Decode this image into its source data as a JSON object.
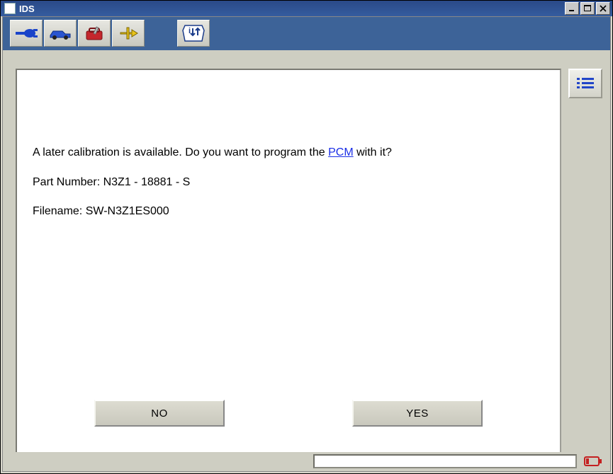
{
  "window": {
    "title": "IDS"
  },
  "message": {
    "line1_pre": "A later calibration is available. Do you want to program the ",
    "line1_link": "PCM",
    "line1_post": " with it?",
    "part_label": "Part Number:  ",
    "part_value": "N3Z1 - 18881 - S",
    "file_label": "Filename:  ",
    "file_value": "SW-N3Z1ES000"
  },
  "buttons": {
    "no": "NO",
    "yes": "YES"
  },
  "toolbar_icons": [
    "connector-icon",
    "vehicle-icon",
    "toolbox-icon",
    "pin-icon",
    "swap-icon"
  ],
  "side_icon": "list-icon",
  "status_icon": "battery-low-icon"
}
